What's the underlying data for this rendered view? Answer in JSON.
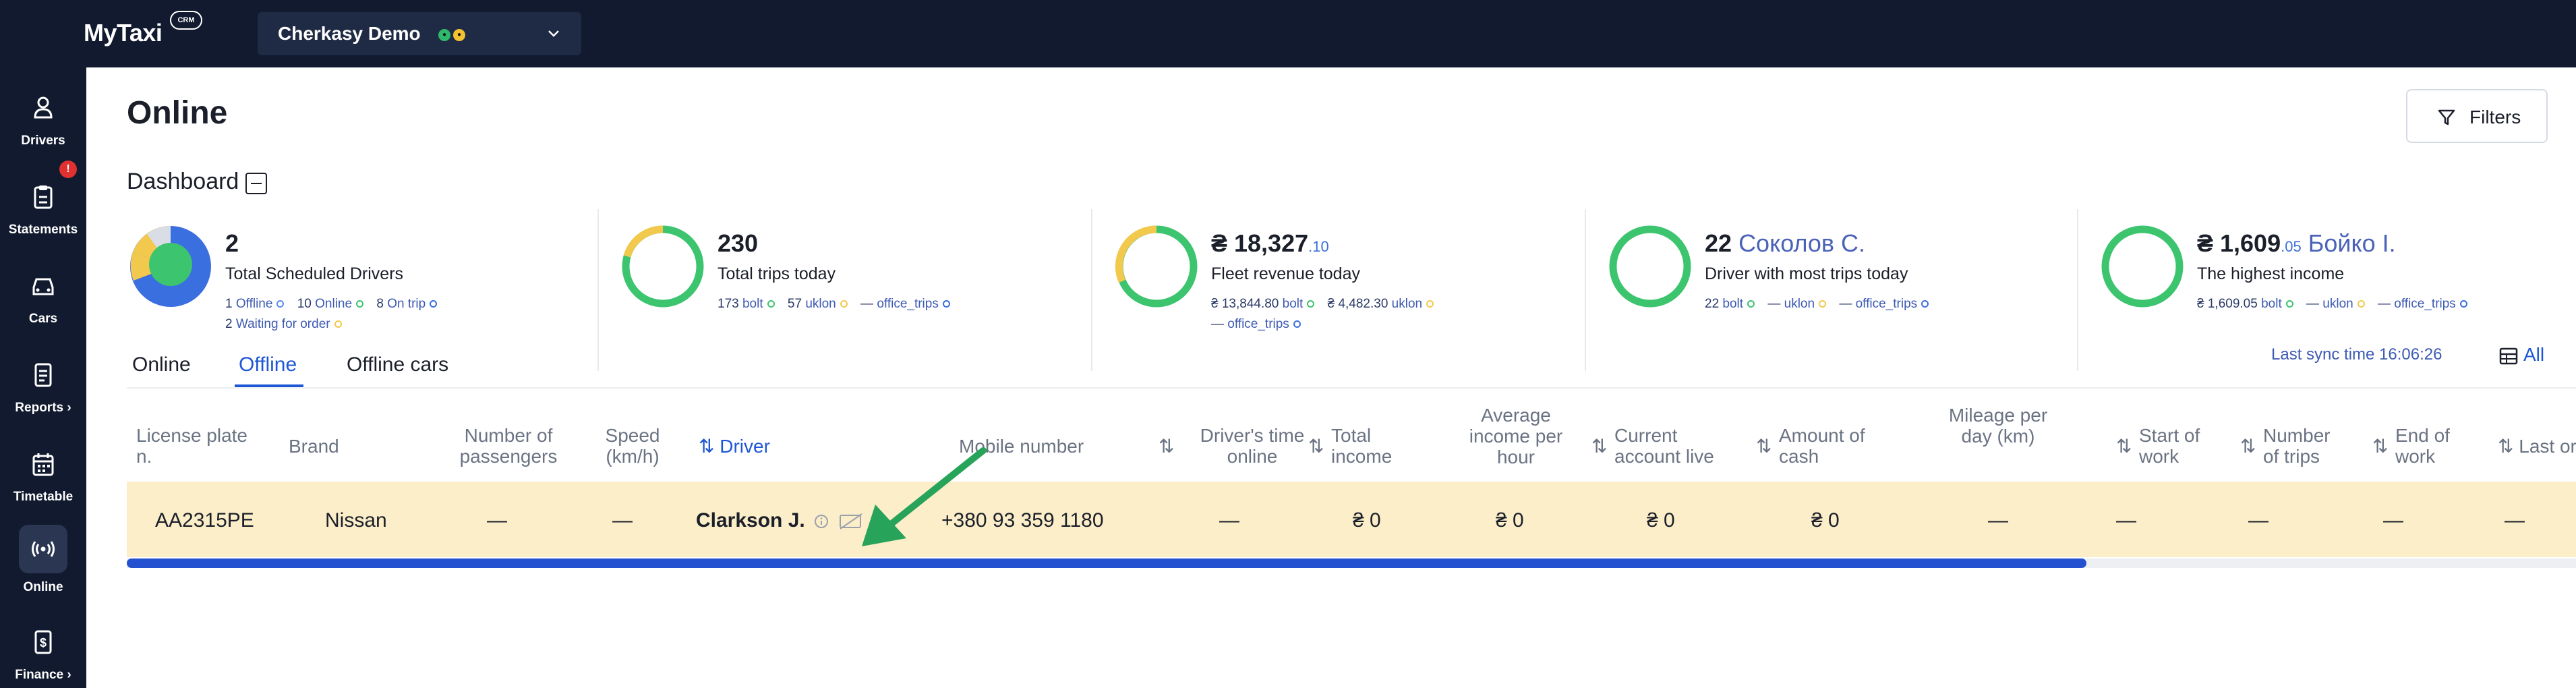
{
  "app": {
    "logo": "MyTaxi",
    "logo_badge": "CRM"
  },
  "company": {
    "name": "Cherkasy Demo",
    "badge_colors": [
      "#2fb86b",
      "#f2c230"
    ]
  },
  "sidebar": {
    "items": [
      {
        "label": "Drivers",
        "icon": "user-icon"
      },
      {
        "label": "Statements",
        "icon": "clipboard-icon",
        "badge": "!"
      },
      {
        "label": "Cars",
        "icon": "car-icon"
      },
      {
        "label": "Reports ›",
        "icon": "report-icon"
      },
      {
        "label": "Timetable",
        "icon": "calendar-icon"
      },
      {
        "label": "Online",
        "icon": "broadcast-icon",
        "active": true
      },
      {
        "label": "Finance ›",
        "icon": "finance-icon"
      }
    ]
  },
  "page": {
    "title": "Online",
    "filters_label": "Filters"
  },
  "dashboard": {
    "title": "Dashboard",
    "cards": [
      {
        "value": "2",
        "label": "Total Scheduled Drivers",
        "legend_line1": [
          {
            "count": "1",
            "label": "Offline",
            "color": "#5b8def"
          },
          {
            "count": "10",
            "label": "Online",
            "color": "#3cc46e"
          },
          {
            "count": "8",
            "label": "On trip",
            "color": "#3a6fe0"
          }
        ],
        "legend_line2": [
          {
            "count": "2",
            "label": "Waiting for order",
            "color": "#f2c94c"
          }
        ]
      },
      {
        "value": "230",
        "label": "Total trips today",
        "legend_line1": [
          {
            "count": "173",
            "label": "bolt",
            "color": "#3cc46e"
          },
          {
            "count": "57",
            "label": "uklon",
            "color": "#f2c94c"
          },
          {
            "count": "—",
            "label": "office_trips",
            "color": "#3a6fe0"
          }
        ]
      },
      {
        "value": "₴ 18,327",
        "value_small": ".10",
        "label": "Fleet revenue today",
        "legend_line1": [
          {
            "count": "₴ 13,844.80",
            "label": "bolt",
            "color": "#3cc46e"
          },
          {
            "count": "₴ 4,482.30",
            "label": "uklon",
            "color": "#f2c94c"
          }
        ],
        "legend_line2": [
          {
            "count": "—",
            "label": "office_trips",
            "color": "#3a6fe0"
          }
        ]
      },
      {
        "value": "22",
        "value_name": "Соколов С.",
        "label": "Driver with most trips today",
        "legend_line1": [
          {
            "count": "22",
            "label": "bolt",
            "color": "#3cc46e"
          },
          {
            "count": "—",
            "label": "uklon",
            "color": "#f2c94c"
          },
          {
            "count": "—",
            "label": "office_trips",
            "color": "#3a6fe0"
          }
        ]
      },
      {
        "value": "₴ 1,609",
        "value_small": ".05",
        "value_name": "Бойко І.",
        "label": "The highest income",
        "legend_line1": [
          {
            "count": "₴ 1,609.05",
            "label": "bolt",
            "color": "#3cc46e"
          },
          {
            "count": "—",
            "label": "uklon",
            "color": "#f2c94c"
          },
          {
            "count": "—",
            "label": "office_trips",
            "color": "#3a6fe0"
          }
        ]
      }
    ]
  },
  "tabs": [
    {
      "label": "Online"
    },
    {
      "label": "Offline",
      "active": true
    },
    {
      "label": "Offline cars"
    }
  ],
  "sync_text": "Last sync time 16:06:26",
  "all_label": "All",
  "table": {
    "columns": [
      "License plate n.",
      "Brand",
      "Number of passengers",
      "Speed (km/h)",
      "Driver",
      "Mobile number",
      "Driver's time online",
      "Total income",
      "Average income per hour",
      "Current account live",
      "Amount of cash",
      "Mileage per day (km)",
      "Start of work",
      "Number of trips",
      "End of work",
      "Last order"
    ],
    "rows": [
      {
        "plate": "AA2315PE",
        "brand": "Nissan",
        "passengers": "—",
        "speed": "—",
        "driver": "Clarkson J.",
        "mobile": "+380 93 359 1180",
        "time_online": "—",
        "total_income": "₴ 0",
        "avg_income": "₴ 0",
        "account_live": "₴ 0",
        "cash": "₴ 0",
        "mileage": "—",
        "start": "—",
        "trips": "—",
        "end": "—",
        "last_order": "—"
      }
    ]
  },
  "scroll_fraction": 0.8
}
